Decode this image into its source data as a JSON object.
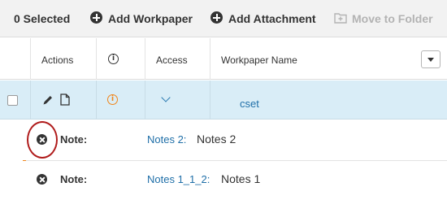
{
  "toolbar": {
    "selected_label": "0 Selected",
    "add_workpaper_label": "Add Workpaper",
    "add_attachment_label": "Add Attachment",
    "move_to_folder_label": "Move to Folder"
  },
  "table": {
    "columns": {
      "actions": "Actions",
      "info_icon": "info-icon",
      "access": "Access",
      "workpaper_name": "Workpaper Name"
    },
    "rows": [
      {
        "workpaper_name": "cset",
        "status_color": "#f0851a",
        "notes": [
          {
            "label": "Note:",
            "link": "Notes 2:",
            "text": "Notes 2"
          },
          {
            "label": "Note:",
            "link": "Notes 1_1_2:",
            "text": "Notes 1"
          }
        ]
      }
    ]
  },
  "colors": {
    "accent": "#f0851a",
    "selected_row": "#d9edf7",
    "link": "#1f6fa8",
    "highlight_ring": "#b01c1c"
  }
}
